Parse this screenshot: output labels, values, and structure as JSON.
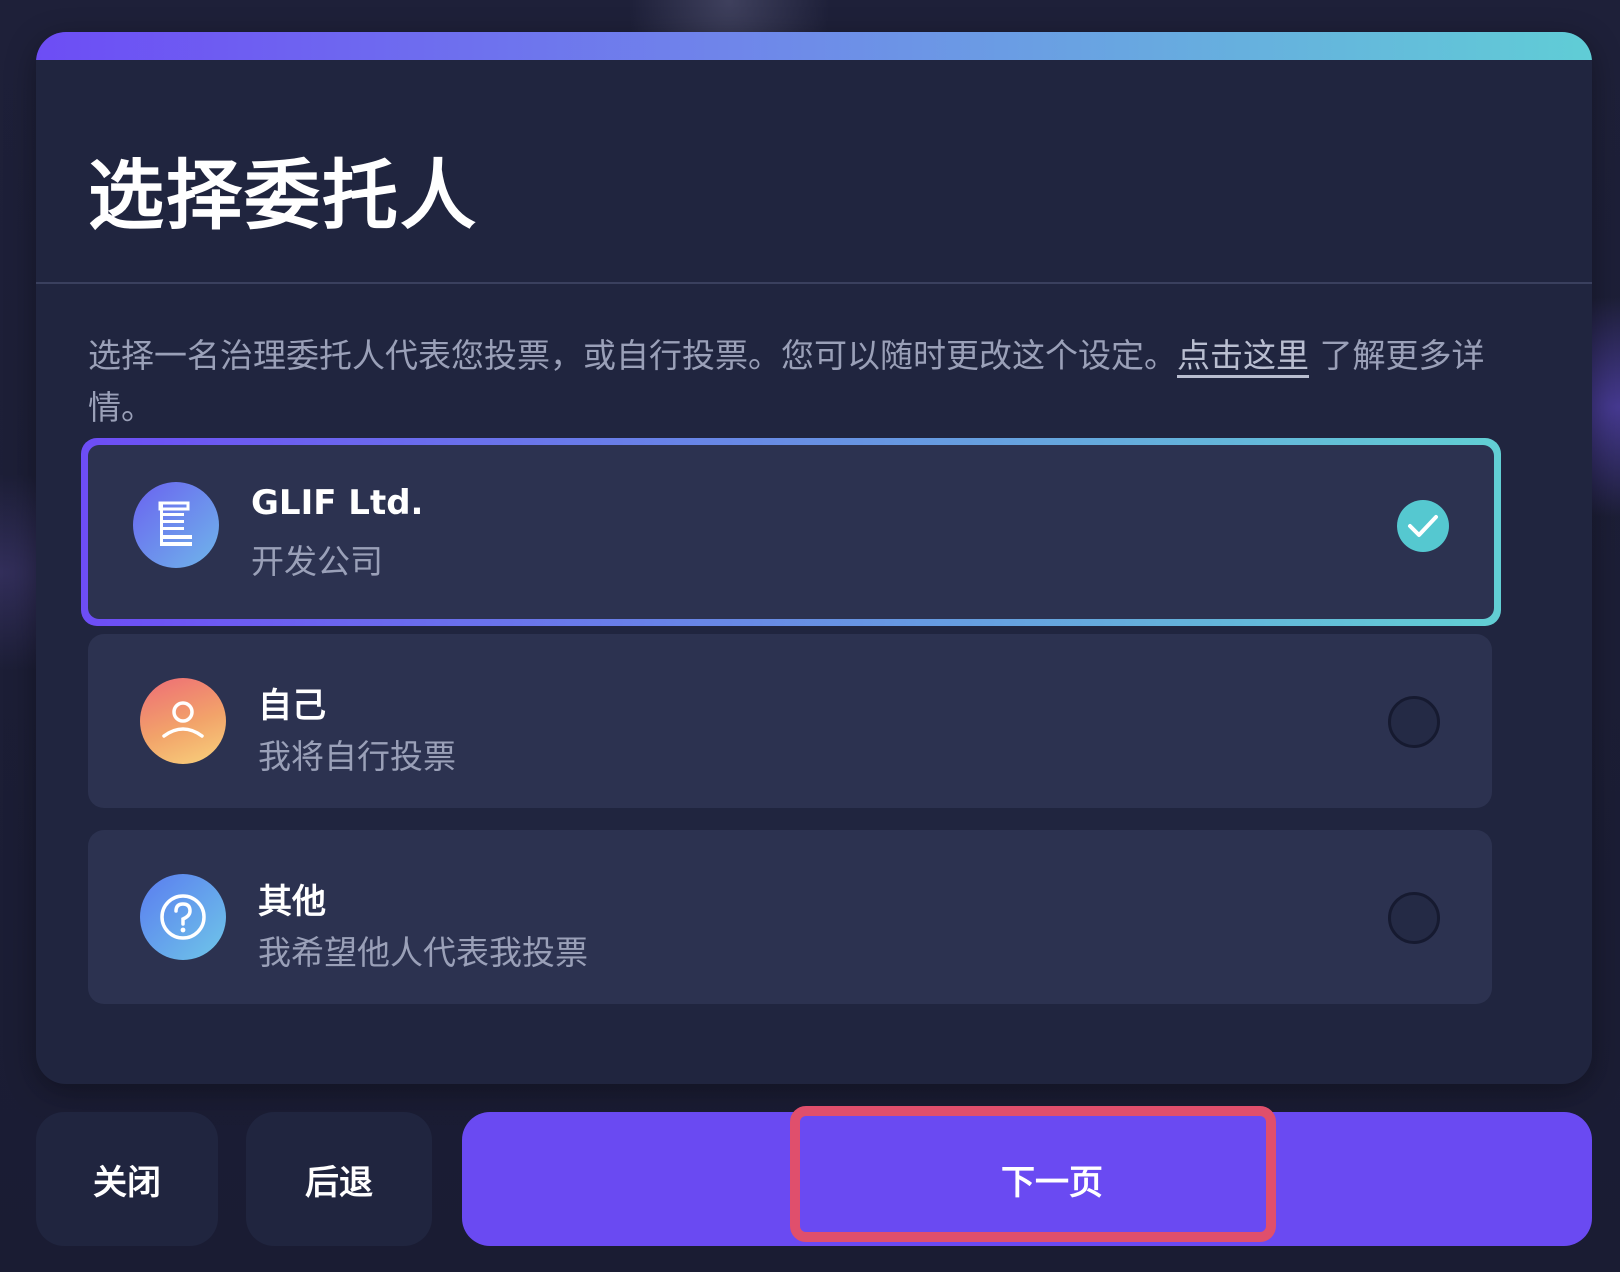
{
  "dialog": {
    "title": "选择委托人",
    "description_text": "选择一名治理委托人代表您投票，或自行投票。您可以随时更改这个设定。",
    "description_link": "点击这里",
    "description_tail": " 了解更多详情。"
  },
  "options": [
    {
      "title": "GLIF Ltd.",
      "subtitle": "开发公司",
      "icon": "document-icon",
      "selected": true
    },
    {
      "title": "自己",
      "subtitle": "我将自行投票",
      "icon": "person-icon",
      "selected": false
    },
    {
      "title": "其他",
      "subtitle": "我希望他人代表我投票",
      "icon": "question-icon",
      "selected": false
    }
  ],
  "footer": {
    "close_label": "关闭",
    "back_label": "后退",
    "next_label": "下一页"
  },
  "colors": {
    "accent": "#6a4af2",
    "selected_check": "#55c8d0",
    "highlight": "#e04f6c"
  }
}
